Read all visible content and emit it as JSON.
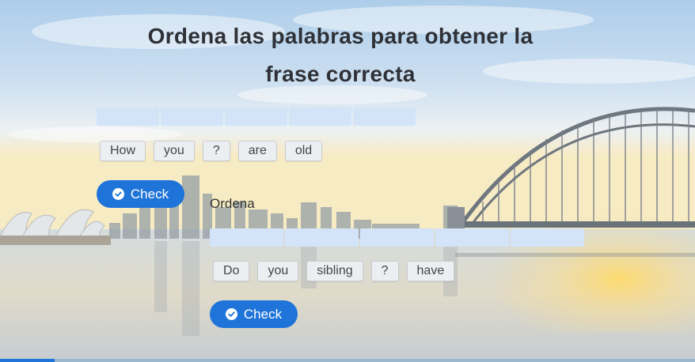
{
  "title": "Ordena las palabras para obtener la frase correcta",
  "exercises": [
    {
      "heading": "",
      "slot_count": 5,
      "words": [
        "How",
        "you",
        "?",
        "are",
        "old"
      ],
      "check_label": "Check"
    },
    {
      "heading": "Ordena",
      "slot_count": 5,
      "words": [
        "Do",
        "you",
        "sibling",
        "?",
        "have"
      ],
      "check_label": "Check"
    }
  ],
  "background": {
    "scene": "sydney-harbour-bridge-skyline-at-sunset"
  },
  "colors": {
    "accent": "#1f74d9",
    "slot": "#d4e4f8",
    "word_bg": "#eceff2"
  },
  "progress": {
    "fraction": 0.08
  }
}
